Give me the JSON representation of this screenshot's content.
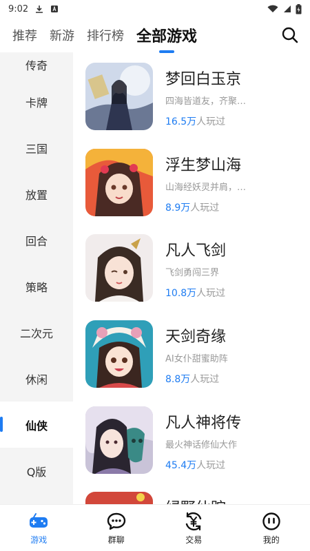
{
  "status_bar": {
    "time": "9:02"
  },
  "tabs": [
    {
      "label": "推荐"
    },
    {
      "label": "新游"
    },
    {
      "label": "排行榜"
    },
    {
      "label": "全部游戏"
    }
  ],
  "active_tab": "全部游戏",
  "sidebar": {
    "items": [
      {
        "label": "传奇"
      },
      {
        "label": "卡牌"
      },
      {
        "label": "三国"
      },
      {
        "label": "放置"
      },
      {
        "label": "回合"
      },
      {
        "label": "策略"
      },
      {
        "label": "二次元"
      },
      {
        "label": "休闲"
      },
      {
        "label": "仙侠"
      },
      {
        "label": "Q版"
      }
    ],
    "active": "仙侠"
  },
  "games": [
    {
      "name": "梦回白玉京",
      "desc": "四海皆道友，齐聚…",
      "plays_num": "16.5万",
      "plays_suffix": "人玩过"
    },
    {
      "name": "浮生梦山海",
      "desc": "山海经妖灵并肩，…",
      "plays_num": "8.9万",
      "plays_suffix": "人玩过"
    },
    {
      "name": "凡人飞剑",
      "desc": "飞剑勇闯三界",
      "plays_num": "10.8万",
      "plays_suffix": "人玩过"
    },
    {
      "name": "天剑奇缘",
      "desc": "AI女仆甜蜜助阵",
      "plays_num": "8.8万",
      "plays_suffix": "人玩过"
    },
    {
      "name": "凡人神将传",
      "desc": "最火神话修仙大作",
      "plays_num": "45.4万",
      "plays_suffix": "人玩过"
    },
    {
      "name": "绿野仙踪"
    }
  ],
  "bottom_nav": {
    "items": [
      {
        "label": "游戏",
        "icon": "gamepad-icon"
      },
      {
        "label": "群聊",
        "icon": "chat-bubble-icon"
      },
      {
        "label": "交易",
        "icon": "yuan-exchange-icon"
      },
      {
        "label": "我的",
        "icon": "profile-face-icon"
      }
    ],
    "active": "游戏"
  },
  "colors": {
    "accent": "#1e7cf2",
    "sidebar_bg": "#f4f4f4",
    "muted_text": "#999999"
  }
}
